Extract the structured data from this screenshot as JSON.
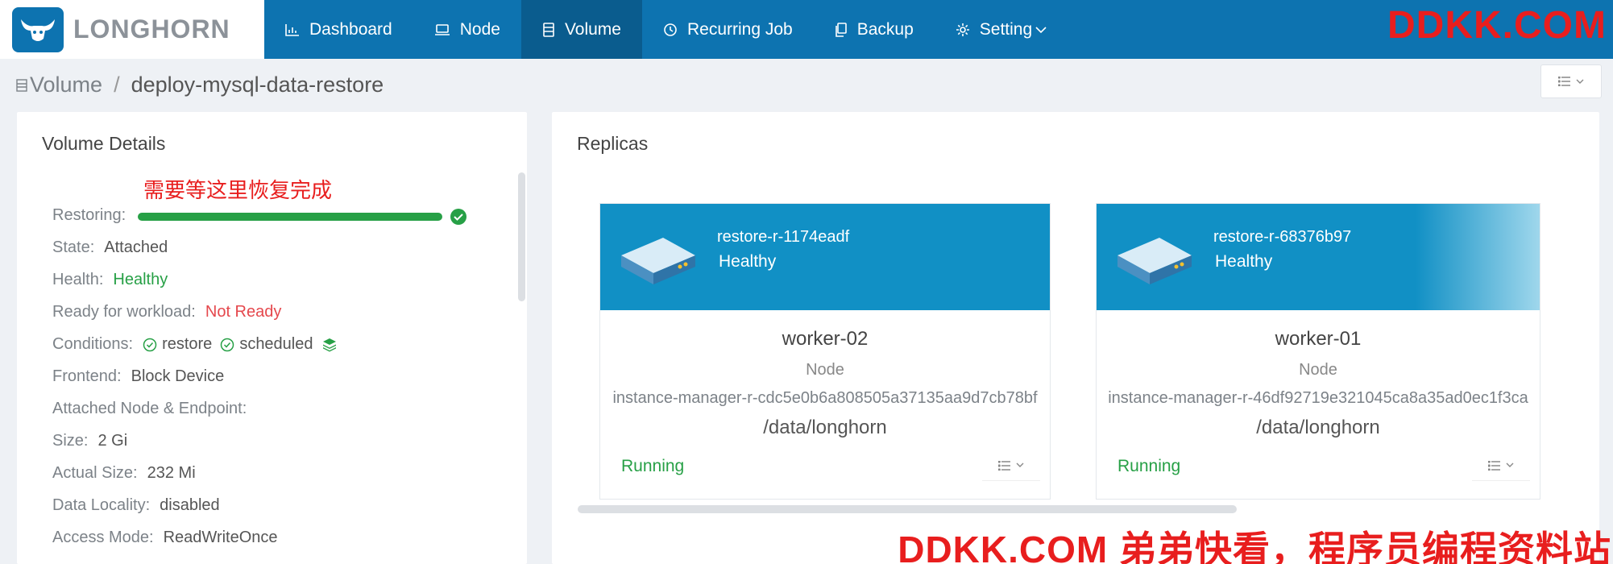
{
  "app": {
    "logo_text": "LONGHORN"
  },
  "nav": {
    "items": [
      {
        "label": "Dashboard",
        "icon": "bar-chart-icon"
      },
      {
        "label": "Node",
        "icon": "laptop-icon"
      },
      {
        "label": "Volume",
        "icon": "database-icon",
        "active": true
      },
      {
        "label": "Recurring Job",
        "icon": "history-icon"
      },
      {
        "label": "Backup",
        "icon": "copy-icon"
      },
      {
        "label": "Setting",
        "icon": "gear-icon"
      }
    ]
  },
  "watermarks": {
    "top": "DDKK.COM",
    "bottom": "DDKK.COM 弟弟快看，程序员编程资料站"
  },
  "breadcrumb": {
    "root": "Volume",
    "separator": "/",
    "current": "deploy-mysql-data-restore"
  },
  "volume_details": {
    "title": "Volume Details",
    "annotation": "需要等这里恢复完成",
    "restoring": {
      "label": "Restoring:",
      "progress": 1.0
    },
    "state": {
      "label": "State:",
      "value": "Attached"
    },
    "health": {
      "label": "Health:",
      "value": "Healthy"
    },
    "ready": {
      "label": "Ready for workload:",
      "value": "Not Ready"
    },
    "conditions": {
      "label": "Conditions:",
      "items": [
        "restore",
        "scheduled"
      ]
    },
    "frontend": {
      "label": "Frontend:",
      "value": "Block Device"
    },
    "attached": {
      "label": "Attached Node & Endpoint:"
    },
    "size": {
      "label": "Size:",
      "value": "2 Gi"
    },
    "actual_size": {
      "label": "Actual Size:",
      "value": "232 Mi"
    },
    "locality": {
      "label": "Data Locality:",
      "value": "disabled"
    },
    "access": {
      "label": "Access Mode:",
      "value": "ReadWriteOnce"
    }
  },
  "replicas": {
    "title": "Replicas",
    "items": [
      {
        "name": "restore-r-1174eadf",
        "health": "Healthy",
        "host": "worker-02",
        "type": "Node",
        "instance_manager": "instance-manager-r-cdc5e0b6a808505a37135aa9d7cb78bf",
        "path": "/data/longhorn",
        "status": "Running"
      },
      {
        "name": "restore-r-68376b97",
        "health": "Healthy",
        "host": "worker-01",
        "type": "Node",
        "instance_manager": "instance-manager-r-46df92719e321045ca8a35ad0ec1f3ca",
        "path": "/data/longhorn",
        "status": "Running"
      }
    ]
  },
  "colors": {
    "nav_bg": "#0d73b0",
    "nav_active": "#0a5c8e",
    "card_head": "#1190c5",
    "success": "#27a046",
    "danger": "#e5484d",
    "watermark": "#e81e1e"
  }
}
